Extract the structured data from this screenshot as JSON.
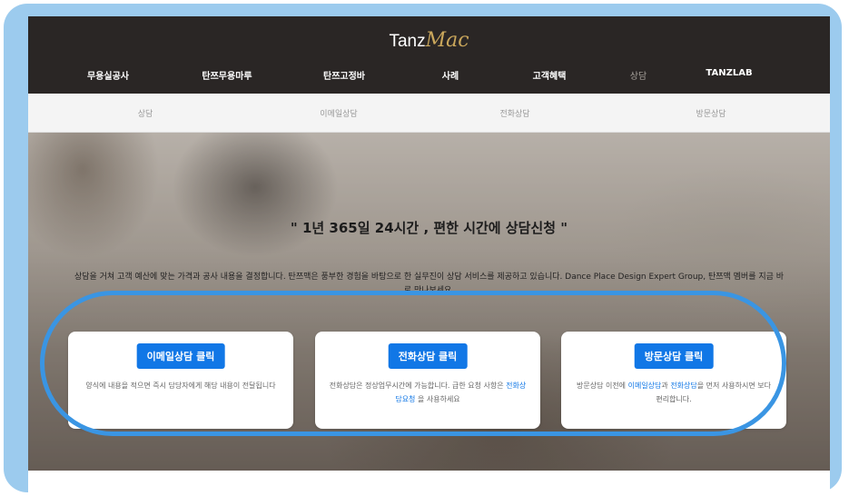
{
  "logo": {
    "part1": "Tanz",
    "part2": "Mac"
  },
  "menu": [
    {
      "label": "무용실공사"
    },
    {
      "label": "탄쯔무용마루"
    },
    {
      "label": "탄쯔고정바"
    },
    {
      "label": "사례"
    },
    {
      "label": "고객혜택"
    },
    {
      "label": "상담"
    },
    {
      "label": "TANZLAB"
    }
  ],
  "subnav": [
    {
      "label": "상담"
    },
    {
      "label": "이메일상담"
    },
    {
      "label": "전화상담"
    },
    {
      "label": "방문상담"
    }
  ],
  "hero": {
    "headline": "\" 1년 365일 24시간 , 편한 시간에 상담신청 \"",
    "description": "상담을 거쳐 고객 예산에 맞는 가격과 공사 내용을 결정합니다. 탄쯔맥은 풍부한 경험을 바탕으로 한 실무진이 상담 서비스를 제공하고 있습니다. Dance Place Design Expert Group, 탄쯔맥 멤버를 지금 바로 만나보세요."
  },
  "cards": [
    {
      "button": "이메일상담 클릭",
      "text_before": "양식에 내용을 적으면 즉시 담당자에게 해당 내용이 전달됩니다",
      "link1": "",
      "text_mid": "",
      "link2": "",
      "text_after": ""
    },
    {
      "button": "전화상담 클릭",
      "text_before": "전화상담은 정상업무시간에 가능합니다. 급한 요청 사항은 ",
      "link1": "전화상담요청",
      "text_mid": " 을 사용하세요",
      "link2": "",
      "text_after": ""
    },
    {
      "button": "방문상담 클릭",
      "text_before": "방문상담 이전에 ",
      "link1": "이메일상담",
      "text_mid": "과 ",
      "link2": "전화상담",
      "text_after": "을 먼저 사용하시면 보다 편리합니다."
    }
  ],
  "colors": {
    "frame": "#9ccbee",
    "nav_bg": "#2a2625",
    "accent": "#1177e6",
    "highlight": "#3a95e3"
  }
}
